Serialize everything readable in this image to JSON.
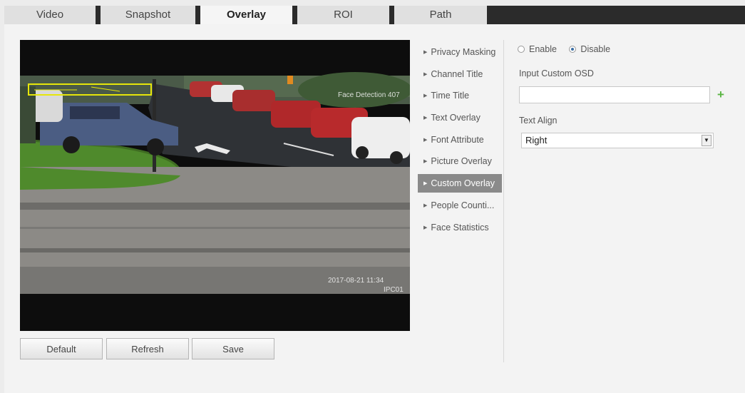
{
  "tabs": [
    {
      "label": "Video"
    },
    {
      "label": "Snapshot"
    },
    {
      "label": "Overlay"
    },
    {
      "label": "ROI"
    },
    {
      "label": "Path"
    }
  ],
  "active_tab": "Overlay",
  "video": {
    "osd_face": "Face Detection 407",
    "osd_time": "2017-08-21 11:34",
    "osd_channel": "IPC01"
  },
  "buttons": {
    "default_label": "Default",
    "refresh_label": "Refresh",
    "save_label": "Save"
  },
  "menu": {
    "items": [
      {
        "label": "Privacy Masking"
      },
      {
        "label": "Channel Title"
      },
      {
        "label": "Time Title"
      },
      {
        "label": "Text Overlay"
      },
      {
        "label": "Font Attribute"
      },
      {
        "label": "Picture Overlay"
      },
      {
        "label": "Custom Overlay"
      },
      {
        "label": "People Counti..."
      },
      {
        "label": "Face Statistics"
      }
    ],
    "active": "Custom Overlay"
  },
  "panel": {
    "enable_label": "Enable",
    "disable_label": "Disable",
    "selected": "Disable",
    "input_label": "Input Custom OSD",
    "input_value": "",
    "text_align_label": "Text Align",
    "text_align_value": "Right"
  },
  "icons": {
    "add": "plus-icon",
    "dropdown": "chevron-down-icon",
    "menu_arrow": "triangle-right-icon"
  },
  "colors": {
    "tab_dark": "#2b2b2b",
    "menu_active": "#8a8a8a",
    "add_icon": "#5ab543",
    "roi_box": "#e6e60a"
  }
}
